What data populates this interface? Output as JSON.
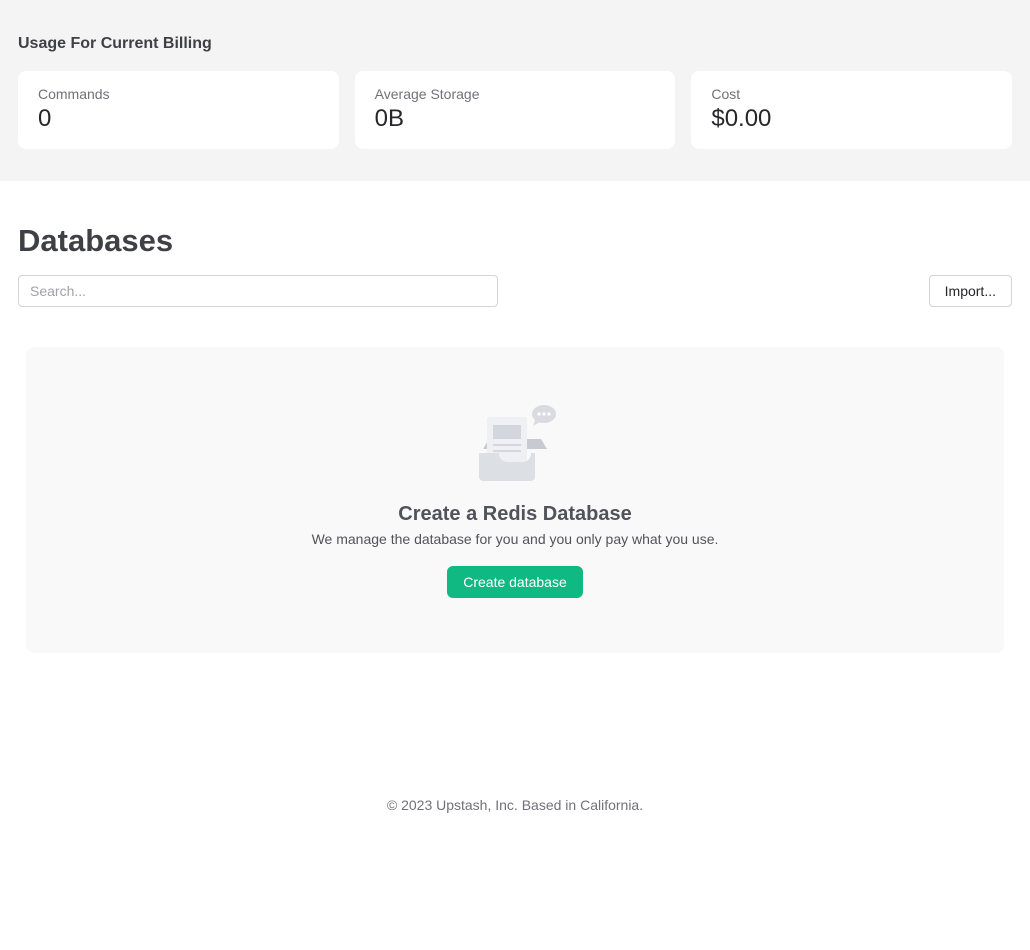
{
  "usage": {
    "title": "Usage For Current Billing",
    "cards": [
      {
        "label": "Commands",
        "value": "0"
      },
      {
        "label": "Average Storage",
        "value": "0B"
      },
      {
        "label": "Cost",
        "value": "$0.00"
      }
    ]
  },
  "databases": {
    "title": "Databases",
    "search_placeholder": "Search...",
    "import_label": "Import...",
    "empty_state": {
      "icon": "inbox-chat-icon",
      "title": "Create a Redis Database",
      "description": "We manage the database for you and you only pay what you use.",
      "button_label": "Create database"
    }
  },
  "footer": {
    "text": "© 2023 Upstash, Inc. Based in California."
  },
  "colors": {
    "accent": "#10b981",
    "usage_background": "#f4f4f4",
    "empty_state_background": "#f9f9f9"
  }
}
